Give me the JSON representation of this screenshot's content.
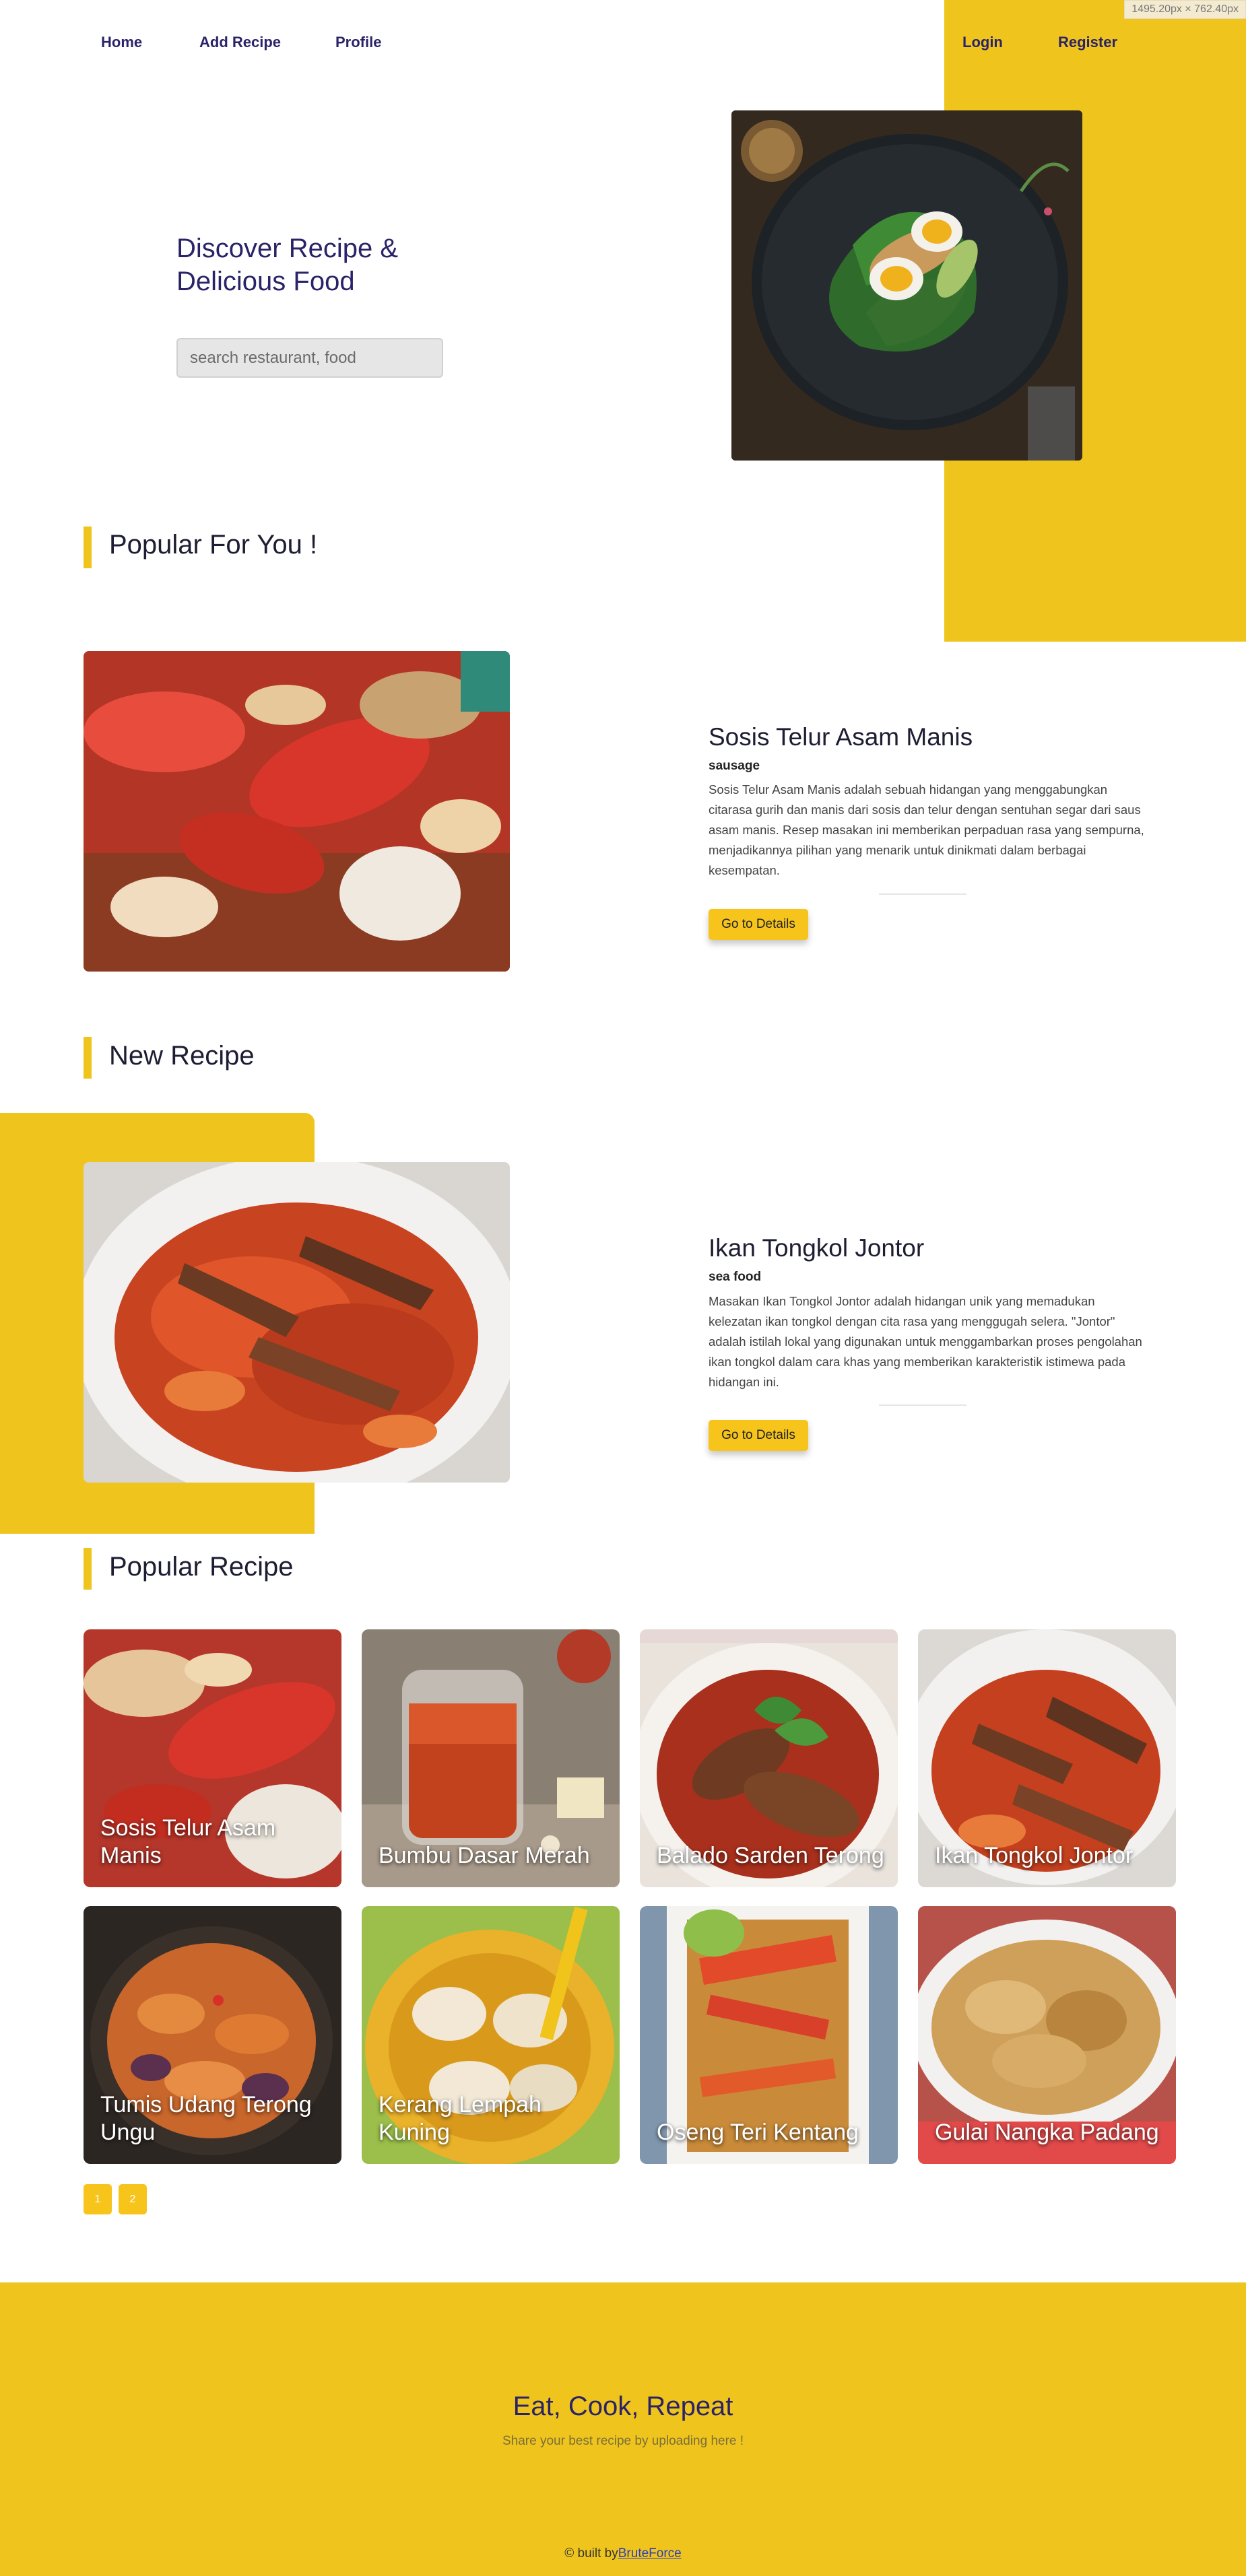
{
  "viewport_badge": "1495.20px × 762.40px",
  "nav": {
    "home": "Home",
    "add_recipe": "Add Recipe",
    "profile": "Profile",
    "login": "Login",
    "register": "Register"
  },
  "hero": {
    "title": "Discover Recipe & Delicious Food",
    "search_placeholder": "search restaurant, food"
  },
  "sections": {
    "popular_for_you": "Popular For You !",
    "new_recipe": "New Recipe",
    "popular_recipe": "Popular Recipe"
  },
  "featured_popular": {
    "title": "Sosis Telur Asam Manis",
    "category": "sausage",
    "description": "Sosis Telur Asam Manis adalah sebuah hidangan yang menggabungkan citarasa gurih dan manis dari sosis dan telur dengan sentuhan segar dari saus asam manis. Resep masakan ini memberikan perpaduan rasa yang sempurna, menjadikannya pilihan yang menarik untuk dinikmati dalam berbagai kesempatan.",
    "button": "Go to Details"
  },
  "featured_new": {
    "title": "Ikan Tongkol Jontor",
    "category": "sea food",
    "description": "Masakan Ikan Tongkol Jontor adalah hidangan unik yang memadukan kelezatan ikan tongkol dengan cita rasa yang menggugah selera. \"Jontor\" adalah istilah lokal yang digunakan untuk menggambarkan proses pengolahan ikan tongkol dalam cara khas yang memberikan karakteristik istimewa pada hidangan ini.",
    "button": "Go to Details"
  },
  "popular_recipes": [
    "Sosis Telur Asam Manis",
    "Bumbu Dasar Merah",
    "Balado Sarden Terong",
    "Ikan Tongkol Jontor",
    "Tumis Udang Terong Ungu",
    "Kerang Lempah Kuning",
    "Oseng Teri Kentang",
    "Gulai Nangka Padang"
  ],
  "pagination": [
    "1",
    "2"
  ],
  "footer": {
    "title": "Eat, Cook, Repeat",
    "subtitle": "Share your best recipe by uploading here !",
    "credit_prefix": "© built by",
    "credit_link": "BruteForce"
  }
}
